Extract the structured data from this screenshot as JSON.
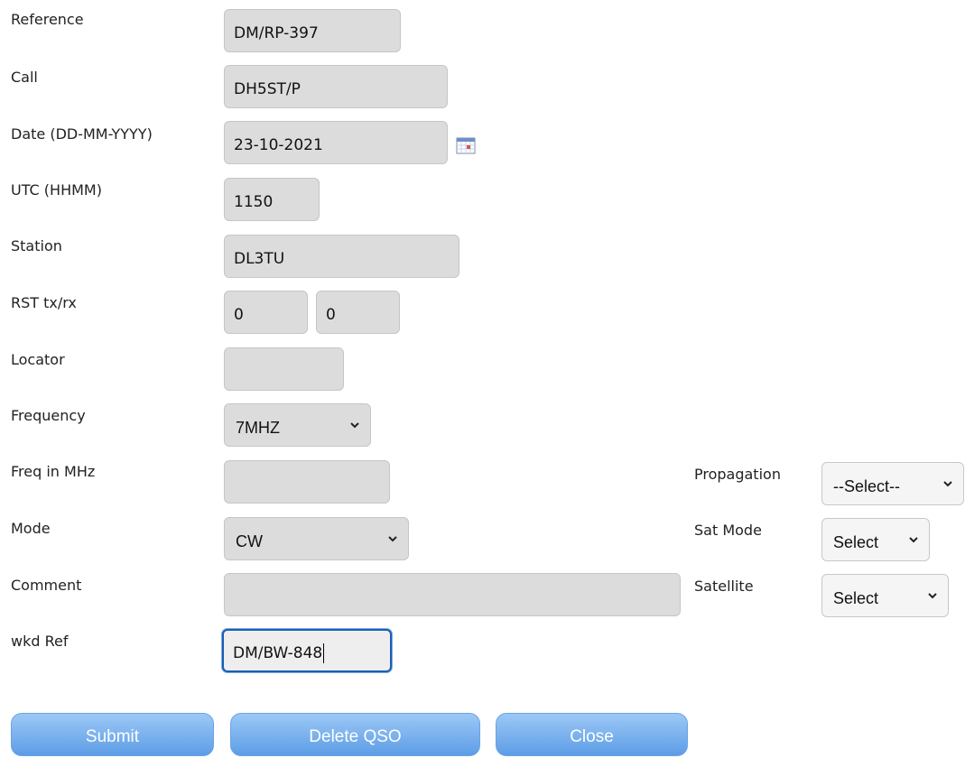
{
  "form": {
    "reference": {
      "label": "Reference",
      "value": "DM/RP-397"
    },
    "call": {
      "label": "Call",
      "value": "DH5ST/P"
    },
    "date": {
      "label": "Date (DD-MM-YYYY)",
      "value": "23-10-2021"
    },
    "utc": {
      "label": "UTC (HHMM)",
      "value": "1150"
    },
    "station": {
      "label": "Station",
      "value": "DL3TU"
    },
    "rst": {
      "label": "RST tx/rx",
      "tx": "0",
      "rx": "0"
    },
    "locator": {
      "label": "Locator",
      "value": ""
    },
    "frequency": {
      "label": "Frequency",
      "selected": "7MHZ"
    },
    "freq_mhz": {
      "label": "Freq in MHz",
      "value": ""
    },
    "mode": {
      "label": "Mode",
      "selected": "CW"
    },
    "comment": {
      "label": "Comment",
      "value": ""
    },
    "wkd_ref": {
      "label": "wkd Ref",
      "value": "DM/BW-848"
    },
    "propagation": {
      "label": "Propagation",
      "selected": "--Select--"
    },
    "sat_mode": {
      "label": "Sat Mode",
      "selected": "Select"
    },
    "satellite": {
      "label": "Satellite",
      "selected": "Select"
    }
  },
  "buttons": {
    "submit": "Submit",
    "delete": "Delete QSO",
    "close": "Close"
  },
  "icons": {
    "calendar": "calendar-icon",
    "chevron": "chevron-down-icon"
  },
  "colors": {
    "button_top": "#9cc8f6",
    "button_bottom": "#5d9de6",
    "field_bg": "#dcdcdc",
    "focus_border": "#1a5fb4"
  }
}
